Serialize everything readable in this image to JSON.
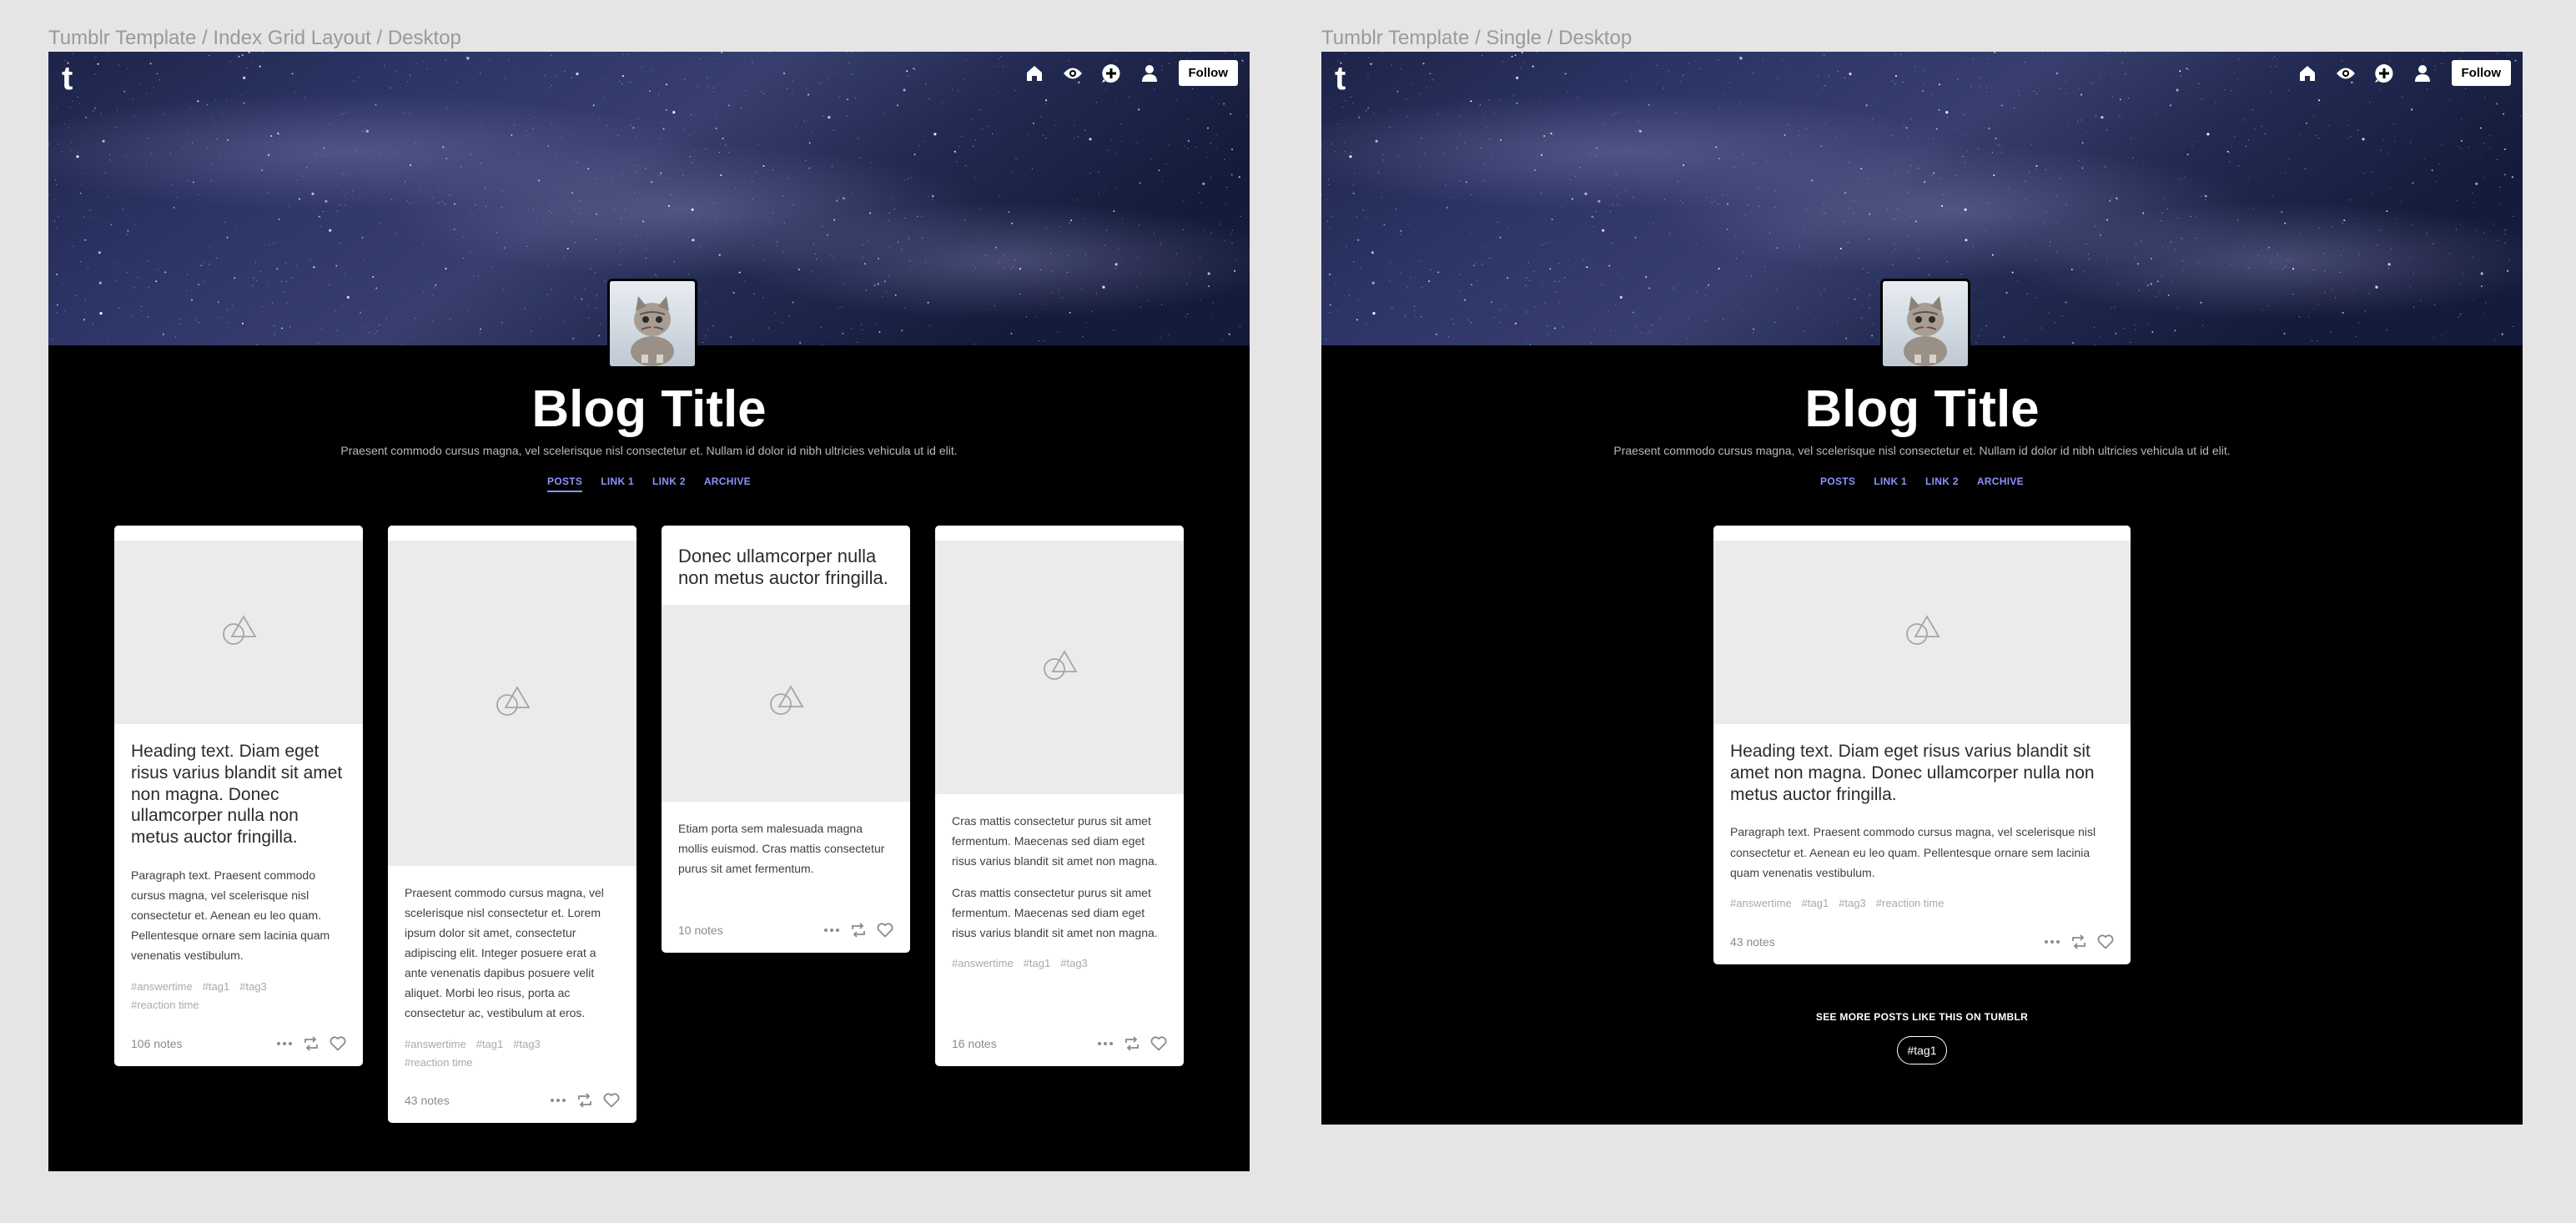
{
  "frames": [
    {
      "label": "Tumblr Template / Index Grid Layout / Desktop",
      "header": {
        "logo": "t",
        "follow_label": "Follow",
        "icons": [
          "home-icon",
          "eye-icon",
          "compose-plus-icon",
          "user-icon"
        ]
      },
      "blog": {
        "title": "Blog Title",
        "description": "Praesent commodo cursus magna, vel scelerisque nisl consectetur et. Nullam id dolor id nibh ultricies vehicula ut id elit.",
        "nav": [
          "POSTS",
          "LINK 1",
          "LINK 2",
          "ARCHIVE"
        ],
        "active_nav": "POSTS"
      },
      "posts": [
        {
          "heading": "Heading text. Diam eget risus varius blandit sit amet non magna. Donec ullamcorper nulla non metus auctor fringilla.",
          "paragraph": "Paragraph text. Praesent commodo cursus magna, vel scelerisque nisl consectetur et. Aenean eu leo quam. Pellentesque ornare sem lacinia quam venenatis vestibulum.",
          "tags": [
            "#answertime",
            "#tag1",
            "#tag3",
            "#reaction time"
          ],
          "notes": "106 notes"
        },
        {
          "paragraph": "Praesent commodo cursus magna, vel scelerisque nisl consectetur et. Lorem ipsum dolor sit amet, consectetur adipiscing elit. Integer posuere erat a ante venenatis dapibus posuere velit aliquet. Morbi leo risus, porta ac consectetur ac, vestibulum at eros.",
          "tags": [
            "#answertime",
            "#tag1",
            "#tag3",
            "#reaction time"
          ],
          "notes": "43 notes"
        },
        {
          "quote": "Donec ullamcorper nulla non metus auctor fringilla.",
          "paragraph": "Etiam porta sem malesuada magna mollis euismod. Cras mattis consectetur purus sit amet fermentum.",
          "notes": "10 notes"
        },
        {
          "paragraph1": "Cras mattis consectetur purus sit amet fermentum. Maecenas sed diam eget risus varius blandit sit amet non magna.",
          "paragraph2": "Cras mattis consectetur purus sit amet fermentum. Maecenas sed diam eget risus varius blandit sit amet non magna.",
          "tags": [
            "#answertime",
            "#tag1",
            "#tag3"
          ],
          "notes": "16 notes"
        }
      ]
    },
    {
      "label": "Tumblr Template / Single / Desktop",
      "header": {
        "logo": "t",
        "follow_label": "Follow",
        "icons": [
          "home-icon",
          "eye-icon",
          "compose-plus-icon",
          "user-icon"
        ]
      },
      "blog": {
        "title": "Blog Title",
        "description": "Praesent commodo cursus magna, vel scelerisque nisl consectetur et. Nullam id dolor id nibh ultricies vehicula ut id elit.",
        "nav": [
          "POSTS",
          "LINK 1",
          "LINK 2",
          "ARCHIVE"
        ]
      },
      "post": {
        "heading": "Heading text. Diam eget risus varius blandit sit amet non magna. Donec ullamcorper nulla non metus auctor fringilla.",
        "paragraph": "Paragraph text. Praesent commodo cursus magna, vel scelerisque nisl consectetur et. Aenean eu leo quam. Pellentesque ornare sem lacinia quam venenatis vestibulum.",
        "tags": [
          "#answertime",
          "#tag1",
          "#tag3",
          "#reaction time"
        ],
        "notes": "43 notes"
      },
      "see_more": "SEE MORE POSTS LIKE THIS ON TUMBLR",
      "tag_pill": "#tag1"
    }
  ],
  "colors": {
    "page_bg": "#e5e5e5",
    "blog_bg": "#000000",
    "nav_link": "#8b93ff",
    "card_bg": "#ffffff",
    "placeholder": "#ebebeb"
  }
}
